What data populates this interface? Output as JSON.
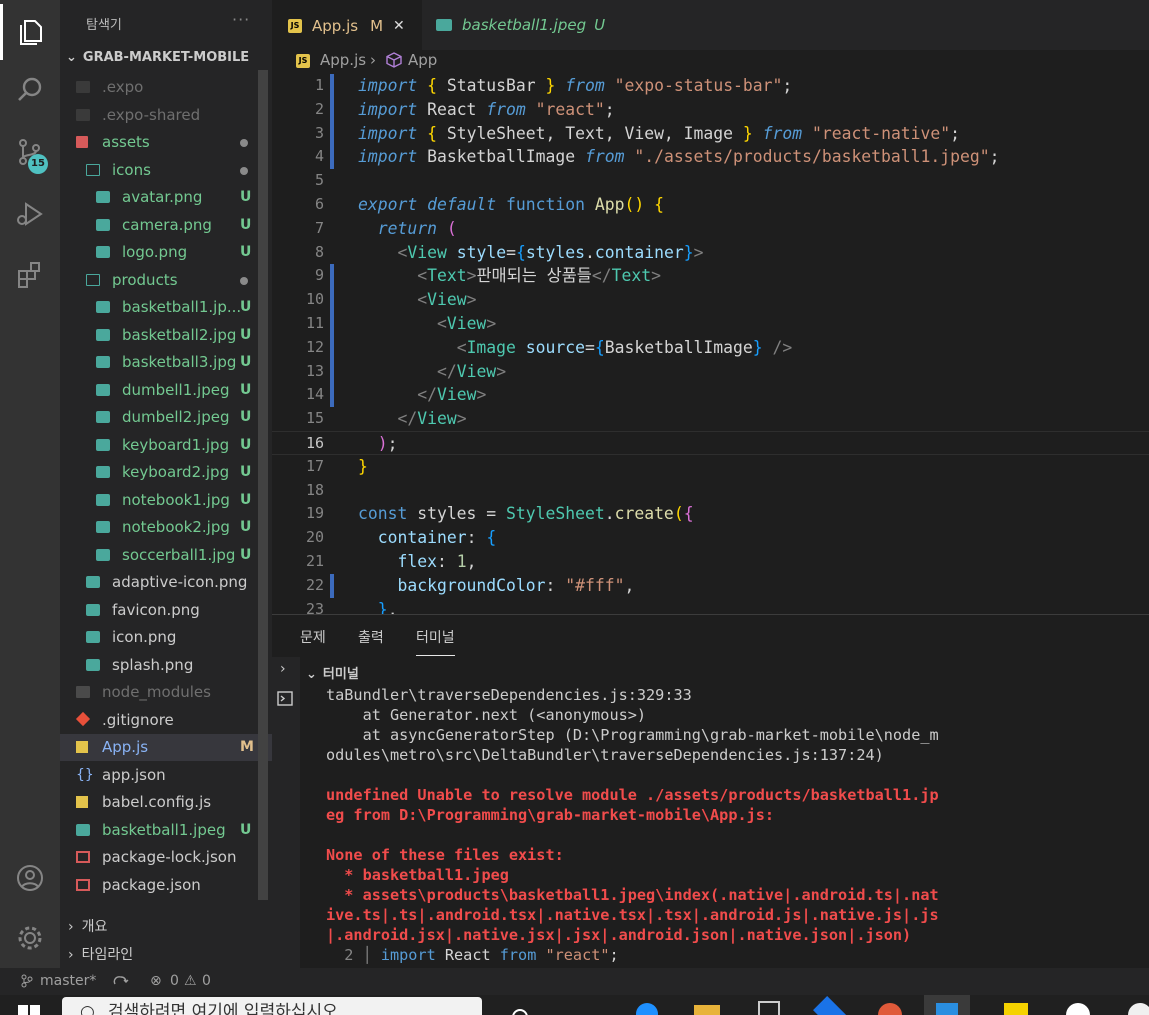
{
  "sidebar": {
    "title": "탐색기",
    "more": "···",
    "root": "GRAB-MARKET-MOBILE",
    "items": [
      {
        "label": ".expo",
        "color": "gray",
        "type": "folder",
        "indent": 0,
        "status": ""
      },
      {
        "label": ".expo-shared",
        "color": "gray",
        "type": "folder",
        "indent": 0,
        "status": ""
      },
      {
        "label": "assets",
        "color": "green",
        "type": "folder",
        "indent": 0,
        "status": "•"
      },
      {
        "label": "icons",
        "color": "green",
        "type": "folder",
        "indent": 1,
        "status": "•"
      },
      {
        "label": "avatar.png",
        "color": "green",
        "type": "image",
        "indent": 2,
        "status": "U"
      },
      {
        "label": "camera.png",
        "color": "green",
        "type": "image",
        "indent": 2,
        "status": "U"
      },
      {
        "label": "logo.png",
        "color": "green",
        "type": "image",
        "indent": 2,
        "status": "U"
      },
      {
        "label": "products",
        "color": "green",
        "type": "folder",
        "indent": 1,
        "status": "•"
      },
      {
        "label": "basketball1.jp...",
        "color": "green",
        "type": "image",
        "indent": 2,
        "status": "U"
      },
      {
        "label": "basketball2.jpg",
        "color": "green",
        "type": "image",
        "indent": 2,
        "status": "U"
      },
      {
        "label": "basketball3.jpg",
        "color": "green",
        "type": "image",
        "indent": 2,
        "status": "U"
      },
      {
        "label": "dumbell1.jpeg",
        "color": "green",
        "type": "image",
        "indent": 2,
        "status": "U"
      },
      {
        "label": "dumbell2.jpeg",
        "color": "green",
        "type": "image",
        "indent": 2,
        "status": "U"
      },
      {
        "label": "keyboard1.jpg",
        "color": "green",
        "type": "image",
        "indent": 2,
        "status": "U"
      },
      {
        "label": "keyboard2.jpg",
        "color": "green",
        "type": "image",
        "indent": 2,
        "status": "U"
      },
      {
        "label": "notebook1.jpg",
        "color": "green",
        "type": "image",
        "indent": 2,
        "status": "U"
      },
      {
        "label": "notebook2.jpg",
        "color": "green",
        "type": "image",
        "indent": 2,
        "status": "U"
      },
      {
        "label": "soccerball1.jpg",
        "color": "green",
        "type": "image",
        "indent": 2,
        "status": "U"
      },
      {
        "label": "adaptive-icon.png",
        "color": "white",
        "type": "image",
        "indent": 1,
        "status": ""
      },
      {
        "label": "favicon.png",
        "color": "white",
        "type": "image",
        "indent": 1,
        "status": ""
      },
      {
        "label": "icon.png",
        "color": "white",
        "type": "image",
        "indent": 1,
        "status": ""
      },
      {
        "label": "splash.png",
        "color": "white",
        "type": "image",
        "indent": 1,
        "status": ""
      },
      {
        "label": "node_modules",
        "color": "gray",
        "type": "folder",
        "indent": 0,
        "status": ""
      },
      {
        "label": ".gitignore",
        "color": "white",
        "type": "git",
        "indent": 0,
        "status": ""
      },
      {
        "label": "App.js",
        "color": "mod",
        "type": "js",
        "indent": 0,
        "status": "M"
      },
      {
        "label": "app.json",
        "color": "white",
        "type": "json",
        "indent": 0,
        "status": ""
      },
      {
        "label": "babel.config.js",
        "color": "white",
        "type": "js",
        "indent": 0,
        "status": ""
      },
      {
        "label": "basketball1.jpeg",
        "color": "green",
        "type": "image",
        "indent": 0,
        "status": "U"
      },
      {
        "label": "package-lock.json",
        "color": "white",
        "type": "pkg",
        "indent": 0,
        "status": ""
      },
      {
        "label": "package.json",
        "color": "white",
        "type": "pkg",
        "indent": 0,
        "status": ""
      }
    ],
    "outline": "개요",
    "timeline": "타임라인"
  },
  "tabs": [
    {
      "label": "App.js",
      "status": "M",
      "close": "✕",
      "active": true
    },
    {
      "label": "basketball1.jpeg",
      "status": "U",
      "active": false
    }
  ],
  "breadcrumb": {
    "file": "App.js",
    "symbol": "App"
  },
  "activity": {
    "scm_badge": "15"
  },
  "code_lines": [
    [
      [
        "kwi",
        "import"
      ],
      [
        "plain",
        " "
      ],
      [
        "br1",
        "{"
      ],
      [
        "plain",
        " StatusBar "
      ],
      [
        "br1",
        "}"
      ],
      [
        "plain",
        " "
      ],
      [
        "kwi",
        "from"
      ],
      [
        "plain",
        " "
      ],
      [
        "s",
        "\"expo-status-bar\""
      ],
      [
        "plain",
        ";"
      ]
    ],
    [
      [
        "kwi",
        "import"
      ],
      [
        "plain",
        " React "
      ],
      [
        "kwi",
        "from"
      ],
      [
        "plain",
        " "
      ],
      [
        "s",
        "\"react\""
      ],
      [
        "plain",
        ";"
      ]
    ],
    [
      [
        "kwi",
        "import"
      ],
      [
        "plain",
        " "
      ],
      [
        "br1",
        "{"
      ],
      [
        "plain",
        " StyleSheet, Text, View, Image "
      ],
      [
        "br1",
        "}"
      ],
      [
        "plain",
        " "
      ],
      [
        "kwi",
        "from"
      ],
      [
        "plain",
        " "
      ],
      [
        "s",
        "\"react-native\""
      ],
      [
        "plain",
        ";"
      ]
    ],
    [
      [
        "kwi",
        "import"
      ],
      [
        "plain",
        " BasketballImage "
      ],
      [
        "kwi",
        "from"
      ],
      [
        "plain",
        " "
      ],
      [
        "s",
        "\"./assets/products/basketball1.jpeg\""
      ],
      [
        "plain",
        ";"
      ]
    ],
    [],
    [
      [
        "kwi",
        "export"
      ],
      [
        "plain",
        " "
      ],
      [
        "kwi",
        "default"
      ],
      [
        "plain",
        " "
      ],
      [
        "k",
        "function"
      ],
      [
        "plain",
        " "
      ],
      [
        "f",
        "App"
      ],
      [
        "br1",
        "()"
      ],
      [
        "plain",
        " "
      ],
      [
        "br1",
        "{"
      ]
    ],
    [
      [
        "plain",
        "  "
      ],
      [
        "kwi",
        "return"
      ],
      [
        "plain",
        " "
      ],
      [
        "br2",
        "("
      ]
    ],
    [
      [
        "plain",
        "    "
      ],
      [
        "pn",
        "<"
      ],
      [
        "tg",
        "View"
      ],
      [
        "plain",
        " "
      ],
      [
        "v",
        "style"
      ],
      [
        "plain",
        "="
      ],
      [
        "br3",
        "{"
      ],
      [
        "v",
        "styles"
      ],
      [
        "plain",
        "."
      ],
      [
        "v",
        "container"
      ],
      [
        "br3",
        "}"
      ],
      [
        "pn",
        ">"
      ]
    ],
    [
      [
        "plain",
        "      "
      ],
      [
        "pn",
        "<"
      ],
      [
        "tg",
        "Text"
      ],
      [
        "pn",
        ">"
      ],
      [
        "plain",
        "판매되는 상품들"
      ],
      [
        "pn",
        "</"
      ],
      [
        "tg",
        "Text"
      ],
      [
        "pn",
        ">"
      ]
    ],
    [
      [
        "plain",
        "      "
      ],
      [
        "pn",
        "<"
      ],
      [
        "tg",
        "View"
      ],
      [
        "pn",
        ">"
      ]
    ],
    [
      [
        "plain",
        "        "
      ],
      [
        "pn",
        "<"
      ],
      [
        "tg",
        "View"
      ],
      [
        "pn",
        ">"
      ]
    ],
    [
      [
        "plain",
        "          "
      ],
      [
        "pn",
        "<"
      ],
      [
        "tg",
        "Image"
      ],
      [
        "plain",
        " "
      ],
      [
        "v",
        "source"
      ],
      [
        "plain",
        "="
      ],
      [
        "br3",
        "{"
      ],
      [
        "plain",
        "BasketballImage"
      ],
      [
        "br3",
        "}"
      ],
      [
        "plain",
        " "
      ],
      [
        "pn",
        "/>"
      ]
    ],
    [
      [
        "plain",
        "        "
      ],
      [
        "pn",
        "</"
      ],
      [
        "tg",
        "View"
      ],
      [
        "pn",
        ">"
      ]
    ],
    [
      [
        "plain",
        "      "
      ],
      [
        "pn",
        "</"
      ],
      [
        "tg",
        "View"
      ],
      [
        "pn",
        ">"
      ]
    ],
    [
      [
        "plain",
        "    "
      ],
      [
        "pn",
        "</"
      ],
      [
        "tg",
        "View"
      ],
      [
        "pn",
        ">"
      ]
    ],
    [
      [
        "plain",
        "  "
      ],
      [
        "br2",
        ")"
      ],
      [
        "plain",
        ";"
      ]
    ],
    [
      [
        "br1",
        "}"
      ]
    ],
    [],
    [
      [
        "k",
        "const"
      ],
      [
        "plain",
        " styles = "
      ],
      [
        "t",
        "StyleSheet"
      ],
      [
        "plain",
        "."
      ],
      [
        "f",
        "create"
      ],
      [
        "br1",
        "("
      ],
      [
        "br2",
        "{"
      ]
    ],
    [
      [
        "plain",
        "  "
      ],
      [
        "v",
        "container"
      ],
      [
        "plain",
        ": "
      ],
      [
        "br3",
        "{"
      ]
    ],
    [
      [
        "plain",
        "    "
      ],
      [
        "v",
        "flex"
      ],
      [
        "plain",
        ": "
      ],
      [
        "n",
        "1"
      ],
      [
        "plain",
        ","
      ]
    ],
    [
      [
        "plain",
        "    "
      ],
      [
        "v",
        "backgroundColor"
      ],
      [
        "plain",
        ": "
      ],
      [
        "s",
        "\"#fff\""
      ],
      [
        "plain",
        ","
      ]
    ],
    [
      [
        "plain",
        "  "
      ],
      [
        "br3",
        "}"
      ],
      [
        "plain",
        ","
      ]
    ]
  ],
  "panel": {
    "tabs": [
      "문제",
      "출력",
      "터미널"
    ],
    "terminal_title": "터미널",
    "lines": [
      {
        "text": "taBundler\\traverseDependencies.js:329:33",
        "color": "w"
      },
      {
        "text": "    at Generator.next (<anonymous>)",
        "color": "w"
      },
      {
        "text": "    at asyncGeneratorStep (D:\\Programming\\grab-market-mobile\\node_m",
        "color": "w"
      },
      {
        "text": "odules\\metro\\src\\DeltaBundler\\traverseDependencies.js:137:24)",
        "color": "w"
      },
      {
        "text": "",
        "color": "w"
      },
      {
        "text": "undefined Unable to resolve module ./assets/products/basketball1.jp",
        "color": "r"
      },
      {
        "text": "eg from D:\\Programming\\grab-market-mobile\\App.js:",
        "color": "r"
      },
      {
        "text": "",
        "color": "w"
      },
      {
        "text": "None of these files exist:",
        "color": "r"
      },
      {
        "text": "  * basketball1.jpeg",
        "color": "r"
      },
      {
        "text": "  * assets\\products\\basketball1.jpeg\\index(.native|.android.ts|.nat",
        "color": "r"
      },
      {
        "text": "ive.ts|.ts|.android.tsx|.native.tsx|.tsx|.android.js|.native.js|.js",
        "color": "r"
      },
      {
        "text": "|.android.jsx|.native.jsx|.jsx|.android.json|.native.json|.json)",
        "color": "r"
      }
    ],
    "snippet_num": "2",
    "snippet": [
      [
        "k",
        "import"
      ],
      [
        "plain",
        " React "
      ],
      [
        "k",
        "from"
      ],
      [
        "plain",
        " "
      ],
      [
        "s",
        "\"react\""
      ],
      [
        "plain",
        ";"
      ]
    ]
  },
  "status": {
    "branch": "master*",
    "errors": "0",
    "warnings": "0"
  },
  "taskbar": {
    "search_placeholder": "검색하려면 여기에 입력하십시오"
  }
}
